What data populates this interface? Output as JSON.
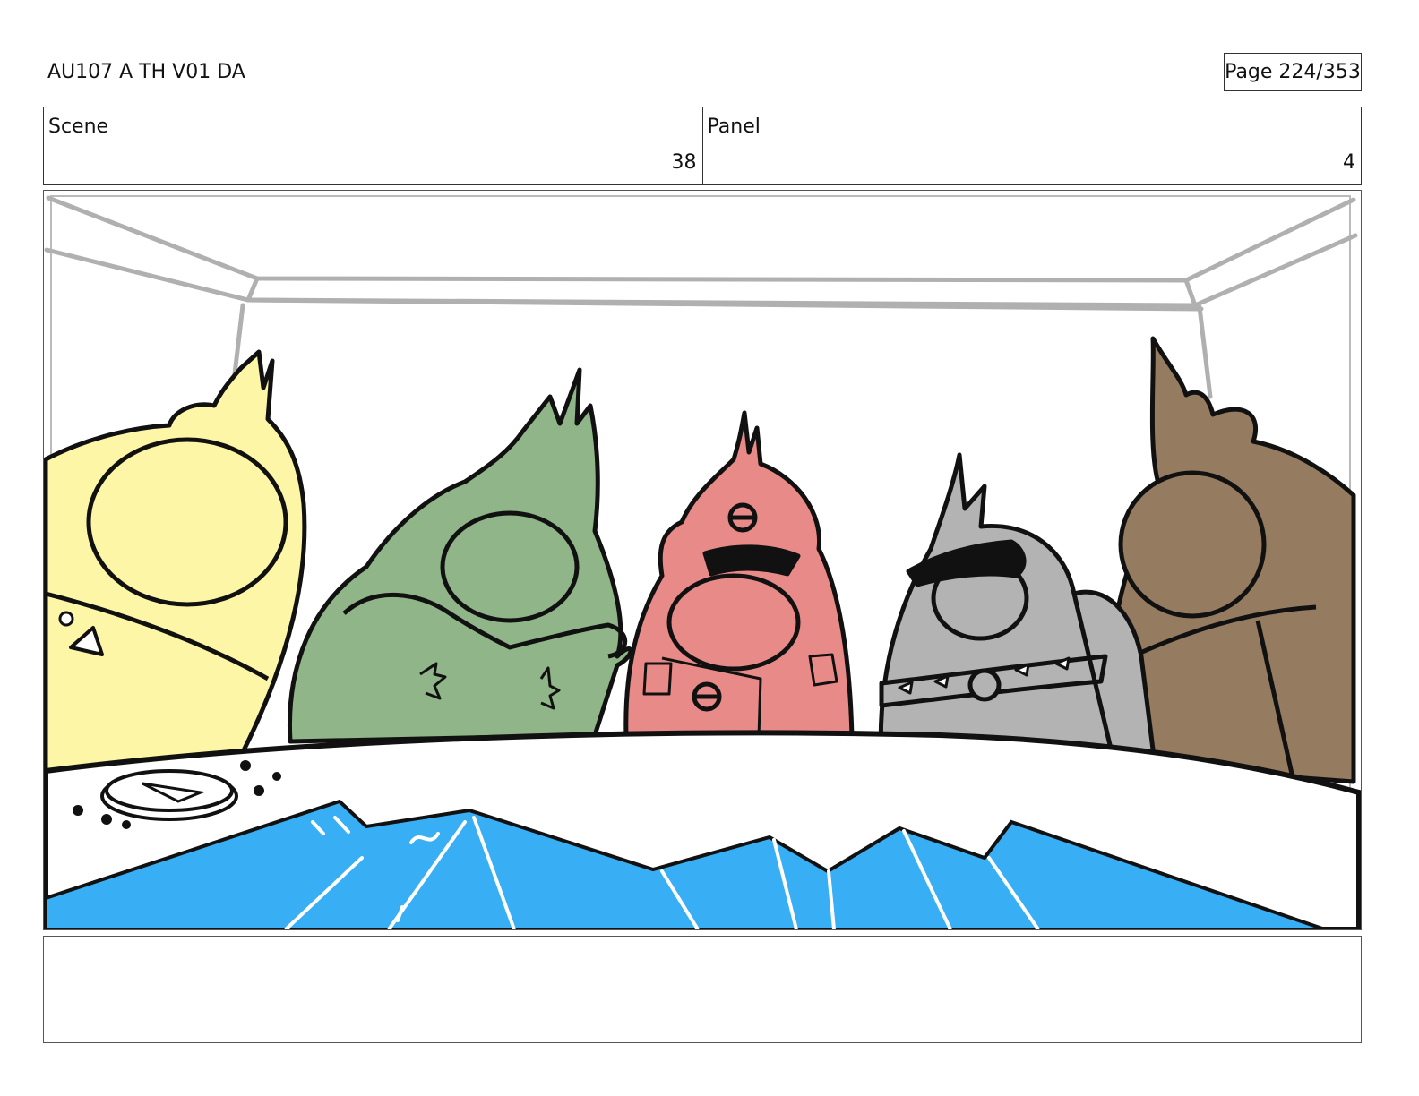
{
  "header": {
    "title": "AU107 A TH V01 DA",
    "page": "Page 224/353"
  },
  "info": {
    "scene_label": "Scene",
    "scene_value": "38",
    "panel_label": "Panel",
    "panel_value": "4"
  },
  "notes": {
    "text": ""
  },
  "colors": {
    "yellow_character": "#fdf6a6",
    "green_character": "#8fb588",
    "red_character": "#e88a88",
    "gray_character": "#b3b3b3",
    "brown_character": "#957b5f",
    "water": "#38aef5"
  }
}
